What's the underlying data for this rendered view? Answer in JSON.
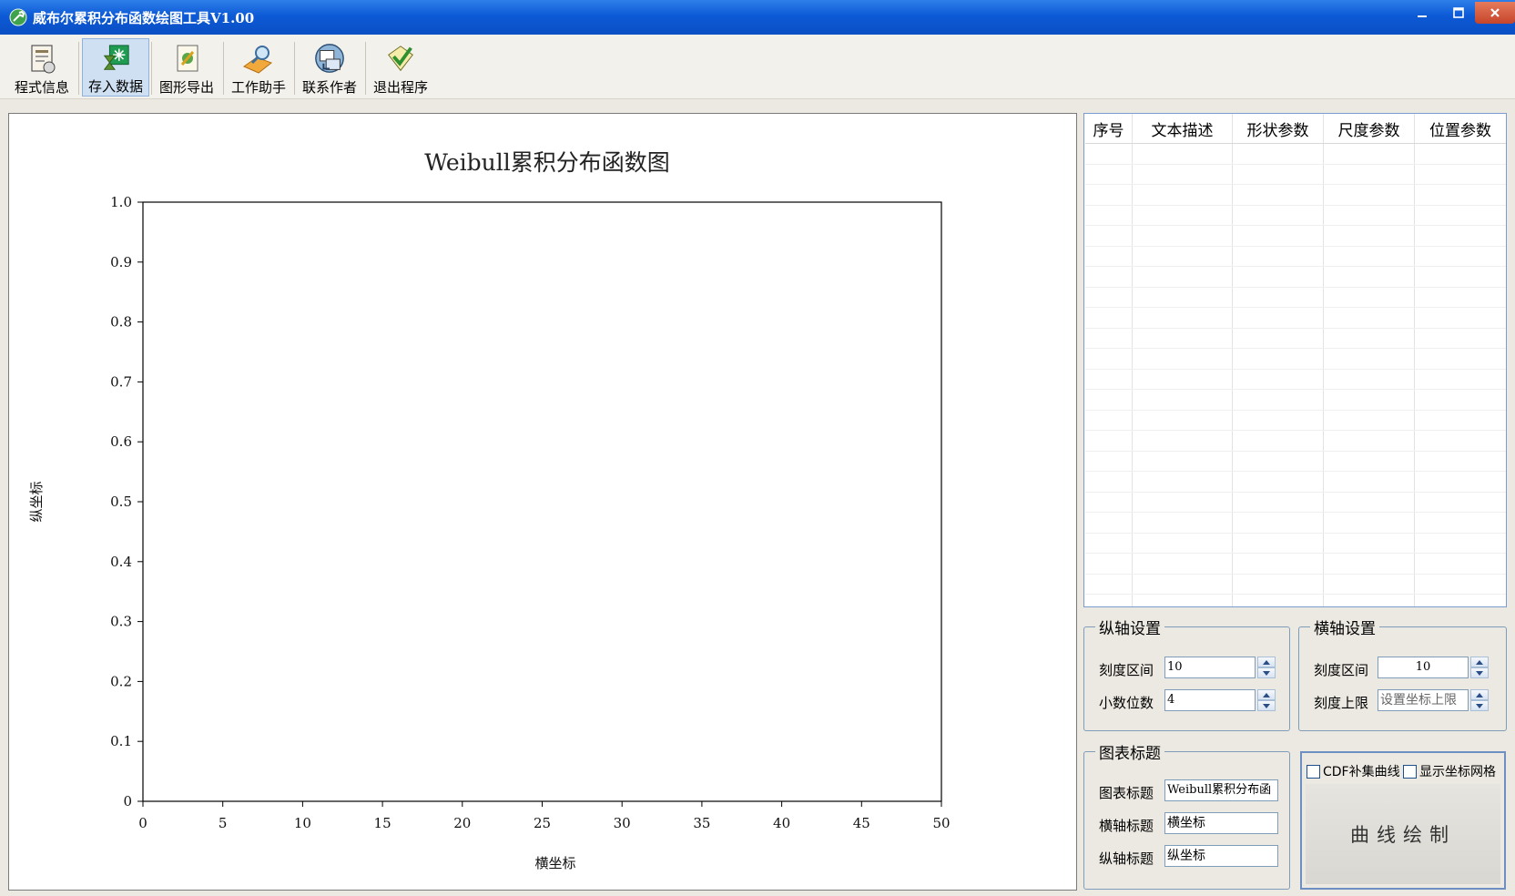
{
  "window": {
    "title": "威布尔累积分布函数绘图工具V1.00",
    "icon": "wrench-app-icon"
  },
  "toolbar": {
    "items": [
      {
        "label": "程式信息",
        "icon": "info-document-icon"
      },
      {
        "label": "存入数据",
        "icon": "save-data-icon",
        "active": true
      },
      {
        "label": "图形导出",
        "icon": "export-image-icon"
      },
      {
        "label": "工作助手",
        "icon": "magnifier-helper-icon"
      },
      {
        "label": "联系作者",
        "icon": "contact-computer-icon"
      },
      {
        "label": "退出程序",
        "icon": "exit-check-icon"
      }
    ]
  },
  "chart_data": {
    "type": "line",
    "title": "Weibull累积分布函数图",
    "xlabel": "横坐标",
    "ylabel": "纵坐标",
    "xlim": [
      0,
      50
    ],
    "ylim": [
      0,
      1
    ],
    "x_ticks": [
      "0",
      "5",
      "10",
      "15",
      "20",
      "25",
      "30",
      "35",
      "40",
      "45",
      "50"
    ],
    "y_ticks": [
      "0",
      "0.1",
      "0.2",
      "0.3",
      "0.4",
      "0.5",
      "0.6",
      "0.7",
      "0.8",
      "0.9",
      "1.0"
    ],
    "series": [],
    "grid": false
  },
  "table": {
    "columns": [
      "序号",
      "文本描述",
      "形状参数",
      "尺度参数",
      "位置参数"
    ],
    "rows": []
  },
  "y_axis_settings": {
    "legend": "纵轴设置",
    "tick_interval_label": "刻度区间",
    "tick_interval_value": "10",
    "decimals_label": "小数位数",
    "decimals_value": "4"
  },
  "x_axis_settings": {
    "legend": "横轴设置",
    "tick_interval_label": "刻度区间",
    "tick_interval_value": "10",
    "upper_limit_label": "刻度上限",
    "upper_limit_placeholder": "设置坐标上限"
  },
  "titles": {
    "legend": "图表标题",
    "chart_title_label": "图表标题",
    "chart_title_value": "Weibull累积分布函",
    "x_title_label": "横轴标题",
    "x_title_value": "横坐标",
    "y_title_label": "纵轴标题",
    "y_title_value": "纵坐标"
  },
  "plot_controls": {
    "cdf_complement_label": "CDF补集曲线",
    "cdf_complement_checked": false,
    "show_grid_label": "显示坐标网格",
    "show_grid_checked": false,
    "draw_button_label": "曲线绘制"
  }
}
